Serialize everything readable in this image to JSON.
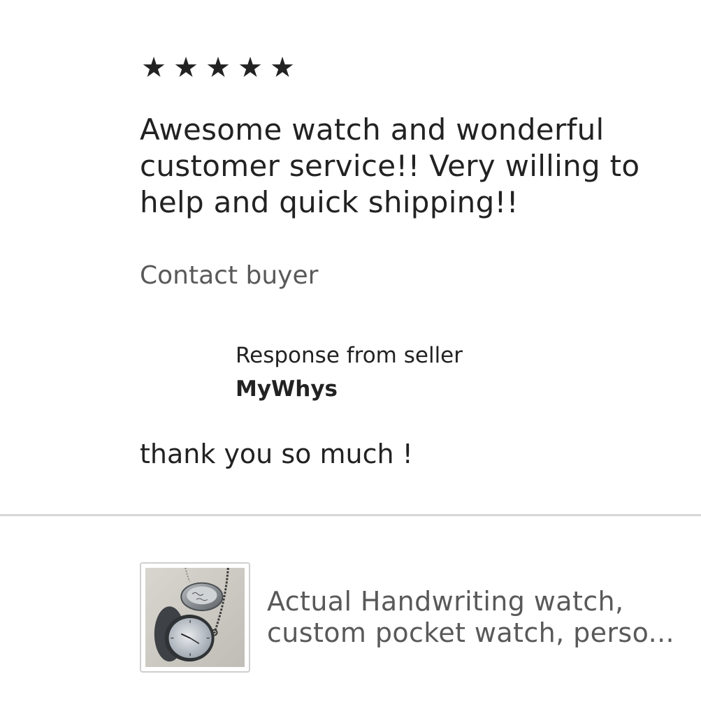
{
  "review": {
    "rating": 5,
    "stars": [
      "★",
      "★",
      "★",
      "★",
      "★"
    ],
    "text": "Awesome watch and wonderful customer service!! Very willing to help and quick shipping!!",
    "contact_label": "Contact buyer"
  },
  "response": {
    "label": "Response from seller",
    "seller_name": "MyWhys",
    "text": "thank you so much !"
  },
  "listing": {
    "title": "Actual Handwriting watch, custom pocket watch, perso..."
  },
  "colors": {
    "text": "#222222",
    "muted": "#595959",
    "divider": "#d6d6d6"
  }
}
